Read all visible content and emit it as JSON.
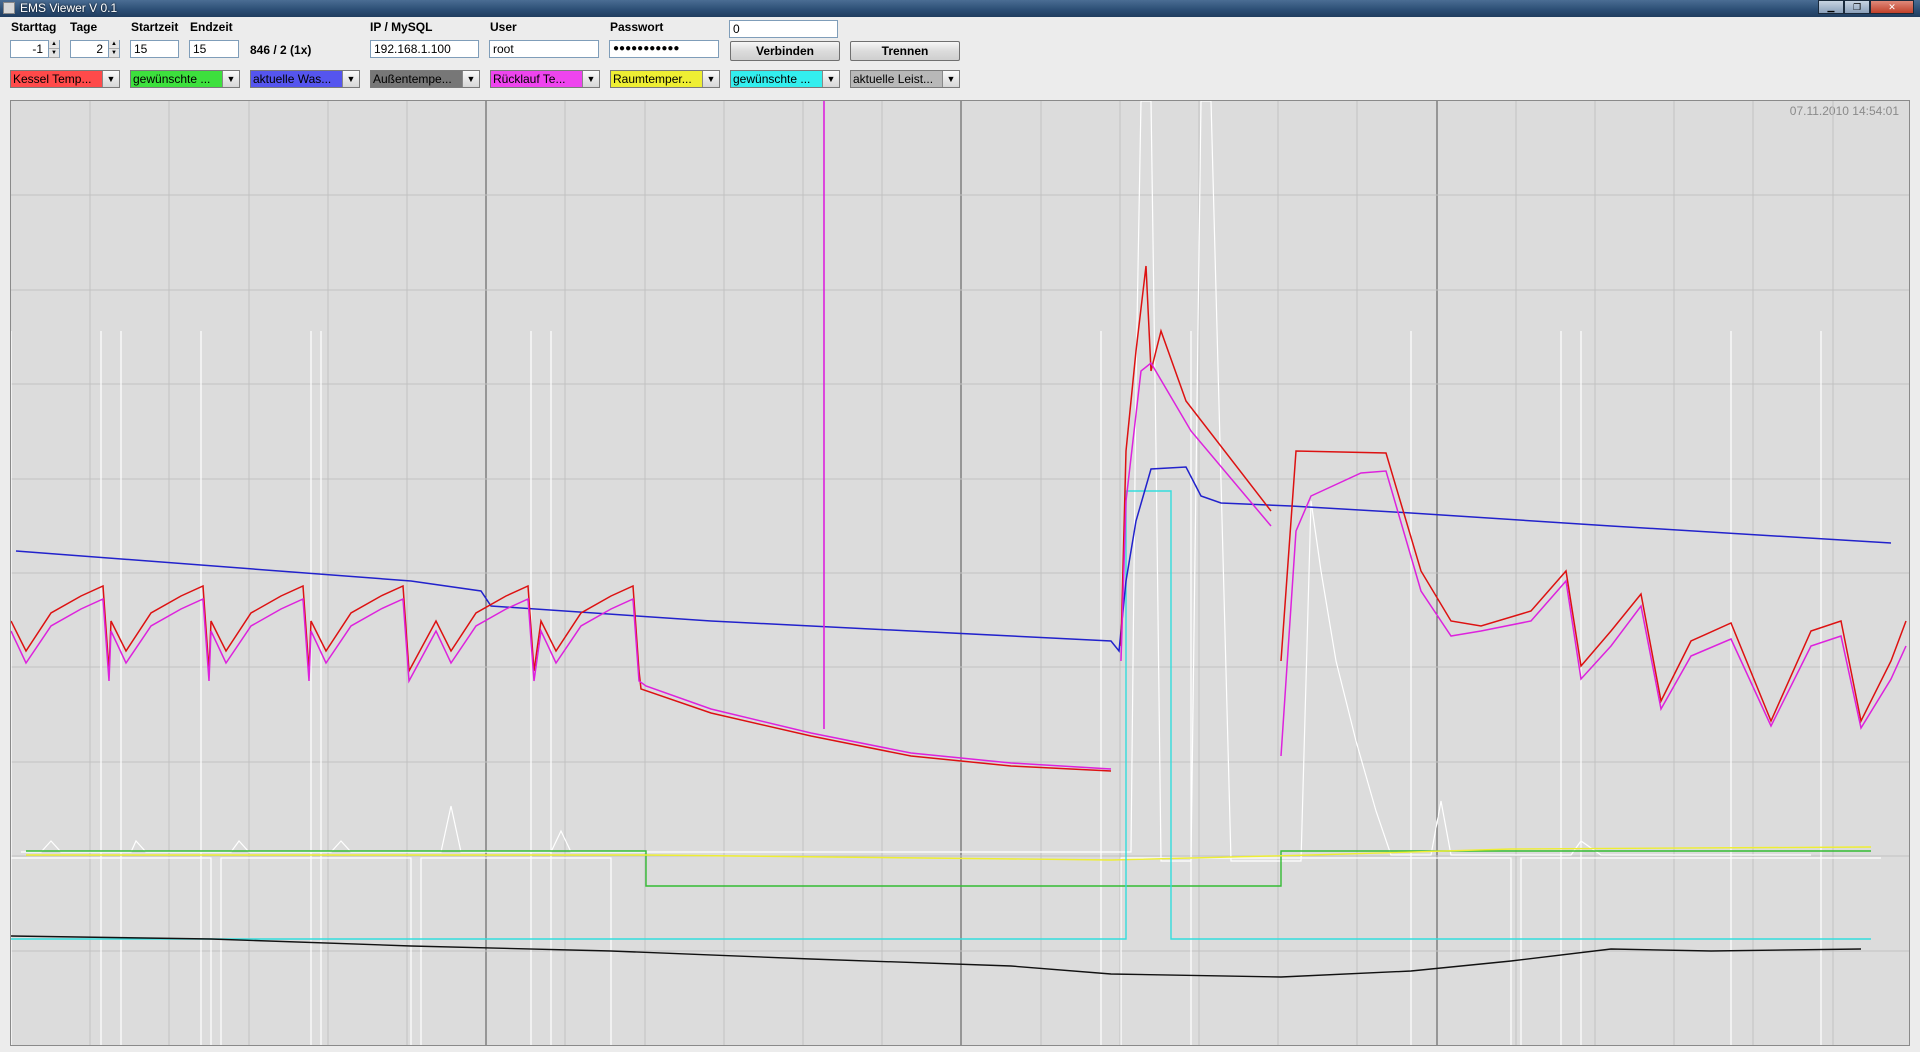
{
  "window": {
    "title": "EMS Viewer V 0.1",
    "buttons": [
      "▁",
      "❐",
      "✕"
    ]
  },
  "controls": {
    "starttag": {
      "label": "Starttag",
      "value": "-1"
    },
    "tage": {
      "label": "Tage",
      "value": "2"
    },
    "startzeit": {
      "label": "Startzeit",
      "value": "15"
    },
    "endzeit": {
      "label": "Endzeit",
      "value": "15"
    },
    "info": "846 / 2 (1x)",
    "ip": {
      "label": "IP / MySQL",
      "value": "192.168.1.100"
    },
    "user": {
      "label": "User",
      "value": "root"
    },
    "passwort": {
      "label": "Passwort",
      "value": "●●●●●●●●●●●"
    },
    "extra_field": "0",
    "connect_label": "Verbinden",
    "disconnect_label": "Trennen"
  },
  "series_selectors": [
    {
      "label": "Kessel Temp...",
      "color": "#ff4a4a"
    },
    {
      "label": "gewünschte ...",
      "color": "#3de03d"
    },
    {
      "label": "aktuelle Was...",
      "color": "#5555ee"
    },
    {
      "label": "Außentempe...",
      "color": "#777777"
    },
    {
      "label": "Rücklauf Te...",
      "color": "#ee44ee"
    },
    {
      "label": "Raumtemper...",
      "color": "#eeee33"
    },
    {
      "label": "gewünschte ...",
      "color": "#33eeee"
    },
    {
      "label": "aktuelle Leist...",
      "color": "#b8b8b8"
    }
  ],
  "plot": {
    "timestamp": "07.11.2010 14:54:01",
    "background": "#dcdcdc",
    "grid_color": "#c2c2c2",
    "major_grid_color": "#505050"
  }
}
